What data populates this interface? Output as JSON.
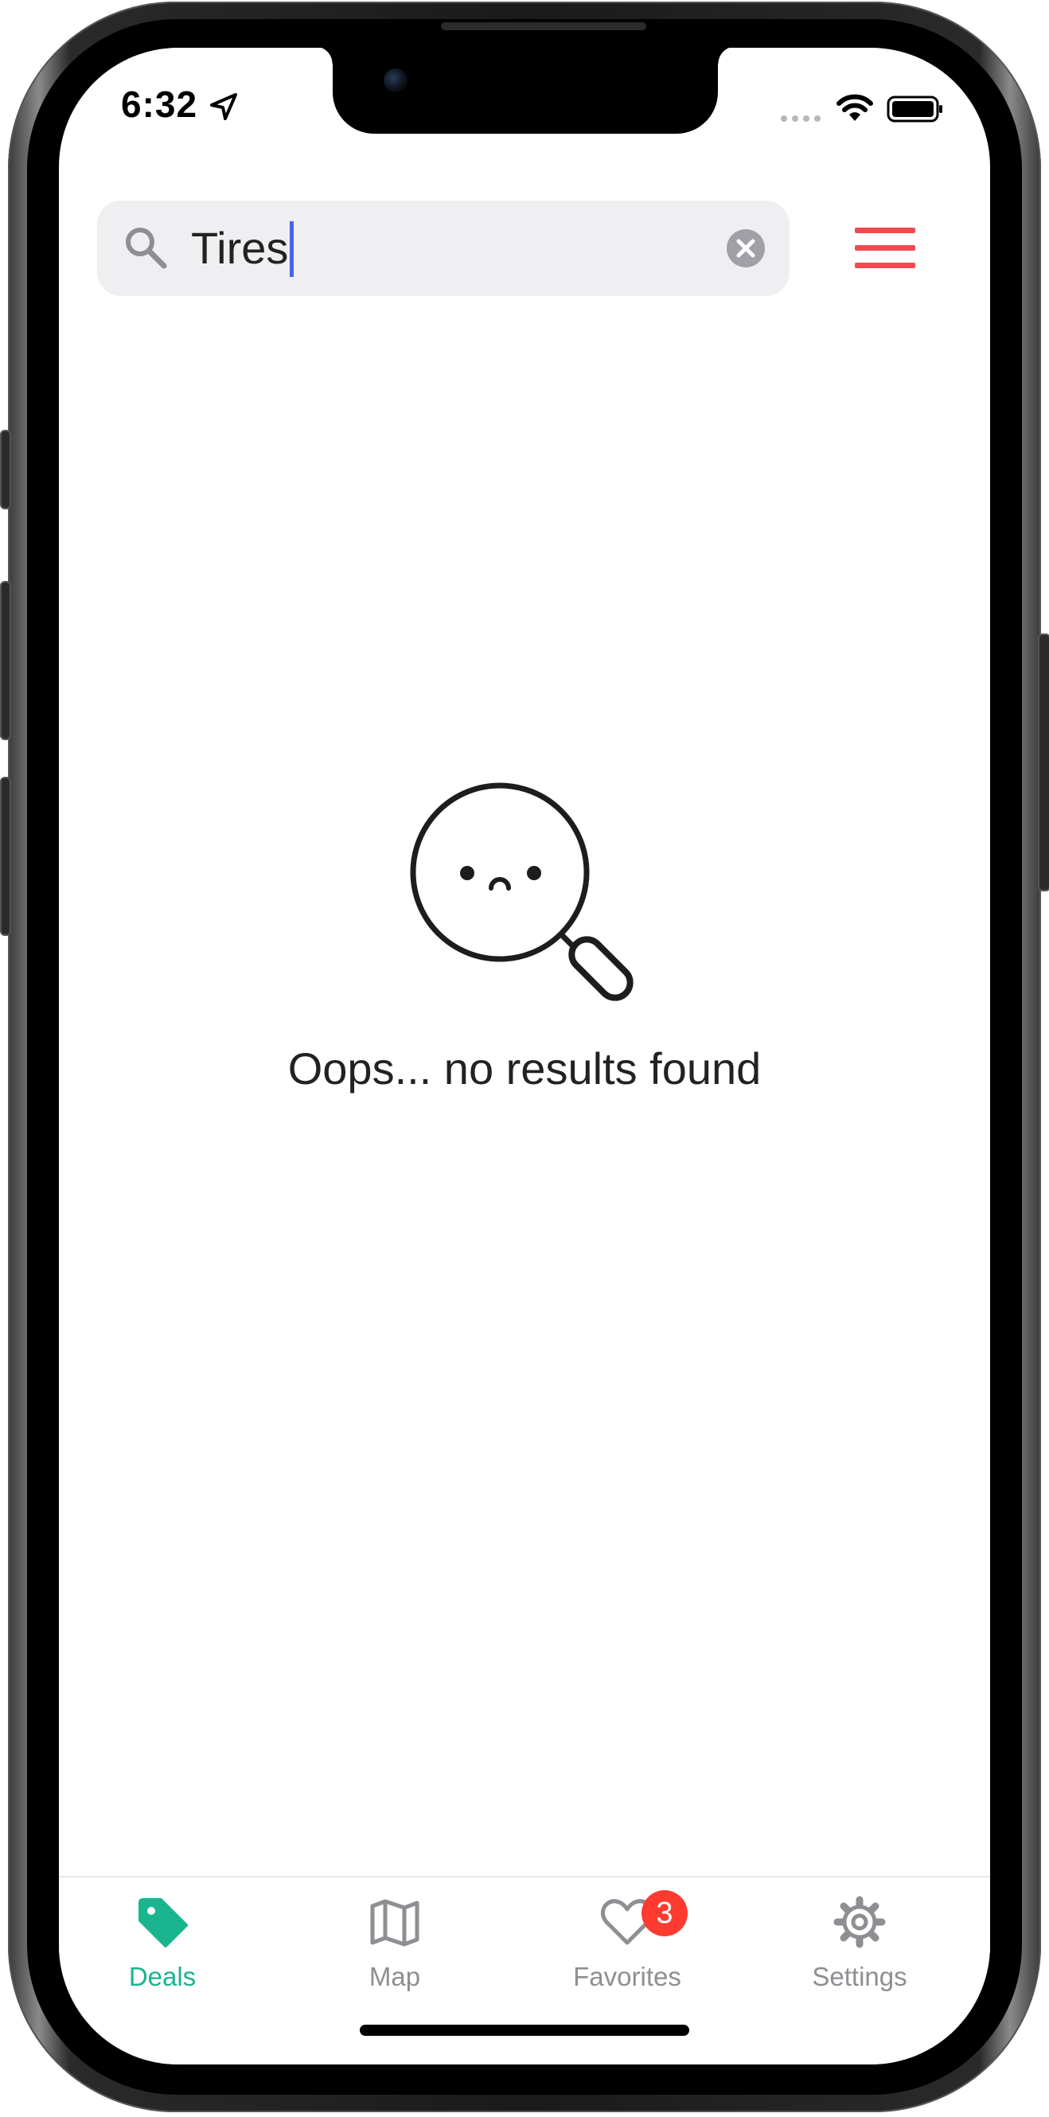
{
  "status_bar": {
    "time": "6:32",
    "icons": [
      "location-arrow-icon",
      "cellular-signal-icon",
      "wifi-icon",
      "battery-icon"
    ]
  },
  "search": {
    "value": "Tires",
    "icon": "search-icon",
    "clear_icon": "clear-icon"
  },
  "header": {
    "menu_icon": "hamburger-menu-icon"
  },
  "empty_state": {
    "icon": "sad-magnifier-icon",
    "message": "Oops... no results found"
  },
  "tab_bar": {
    "tabs": [
      {
        "label": "Deals",
        "icon": "tag-icon",
        "active": true
      },
      {
        "label": "Map",
        "icon": "map-icon",
        "active": false
      },
      {
        "label": "Favorites",
        "icon": "heart-icon",
        "active": false,
        "badge": "3"
      },
      {
        "label": "Settings",
        "icon": "gear-icon",
        "active": false
      }
    ]
  },
  "colors": {
    "accent": "#18b58f",
    "menu_icon": "#f04b4f",
    "badge": "#ff3b30",
    "inactive": "#8e8e93",
    "caret": "#4a66e8",
    "search_background": "#efeff1"
  }
}
